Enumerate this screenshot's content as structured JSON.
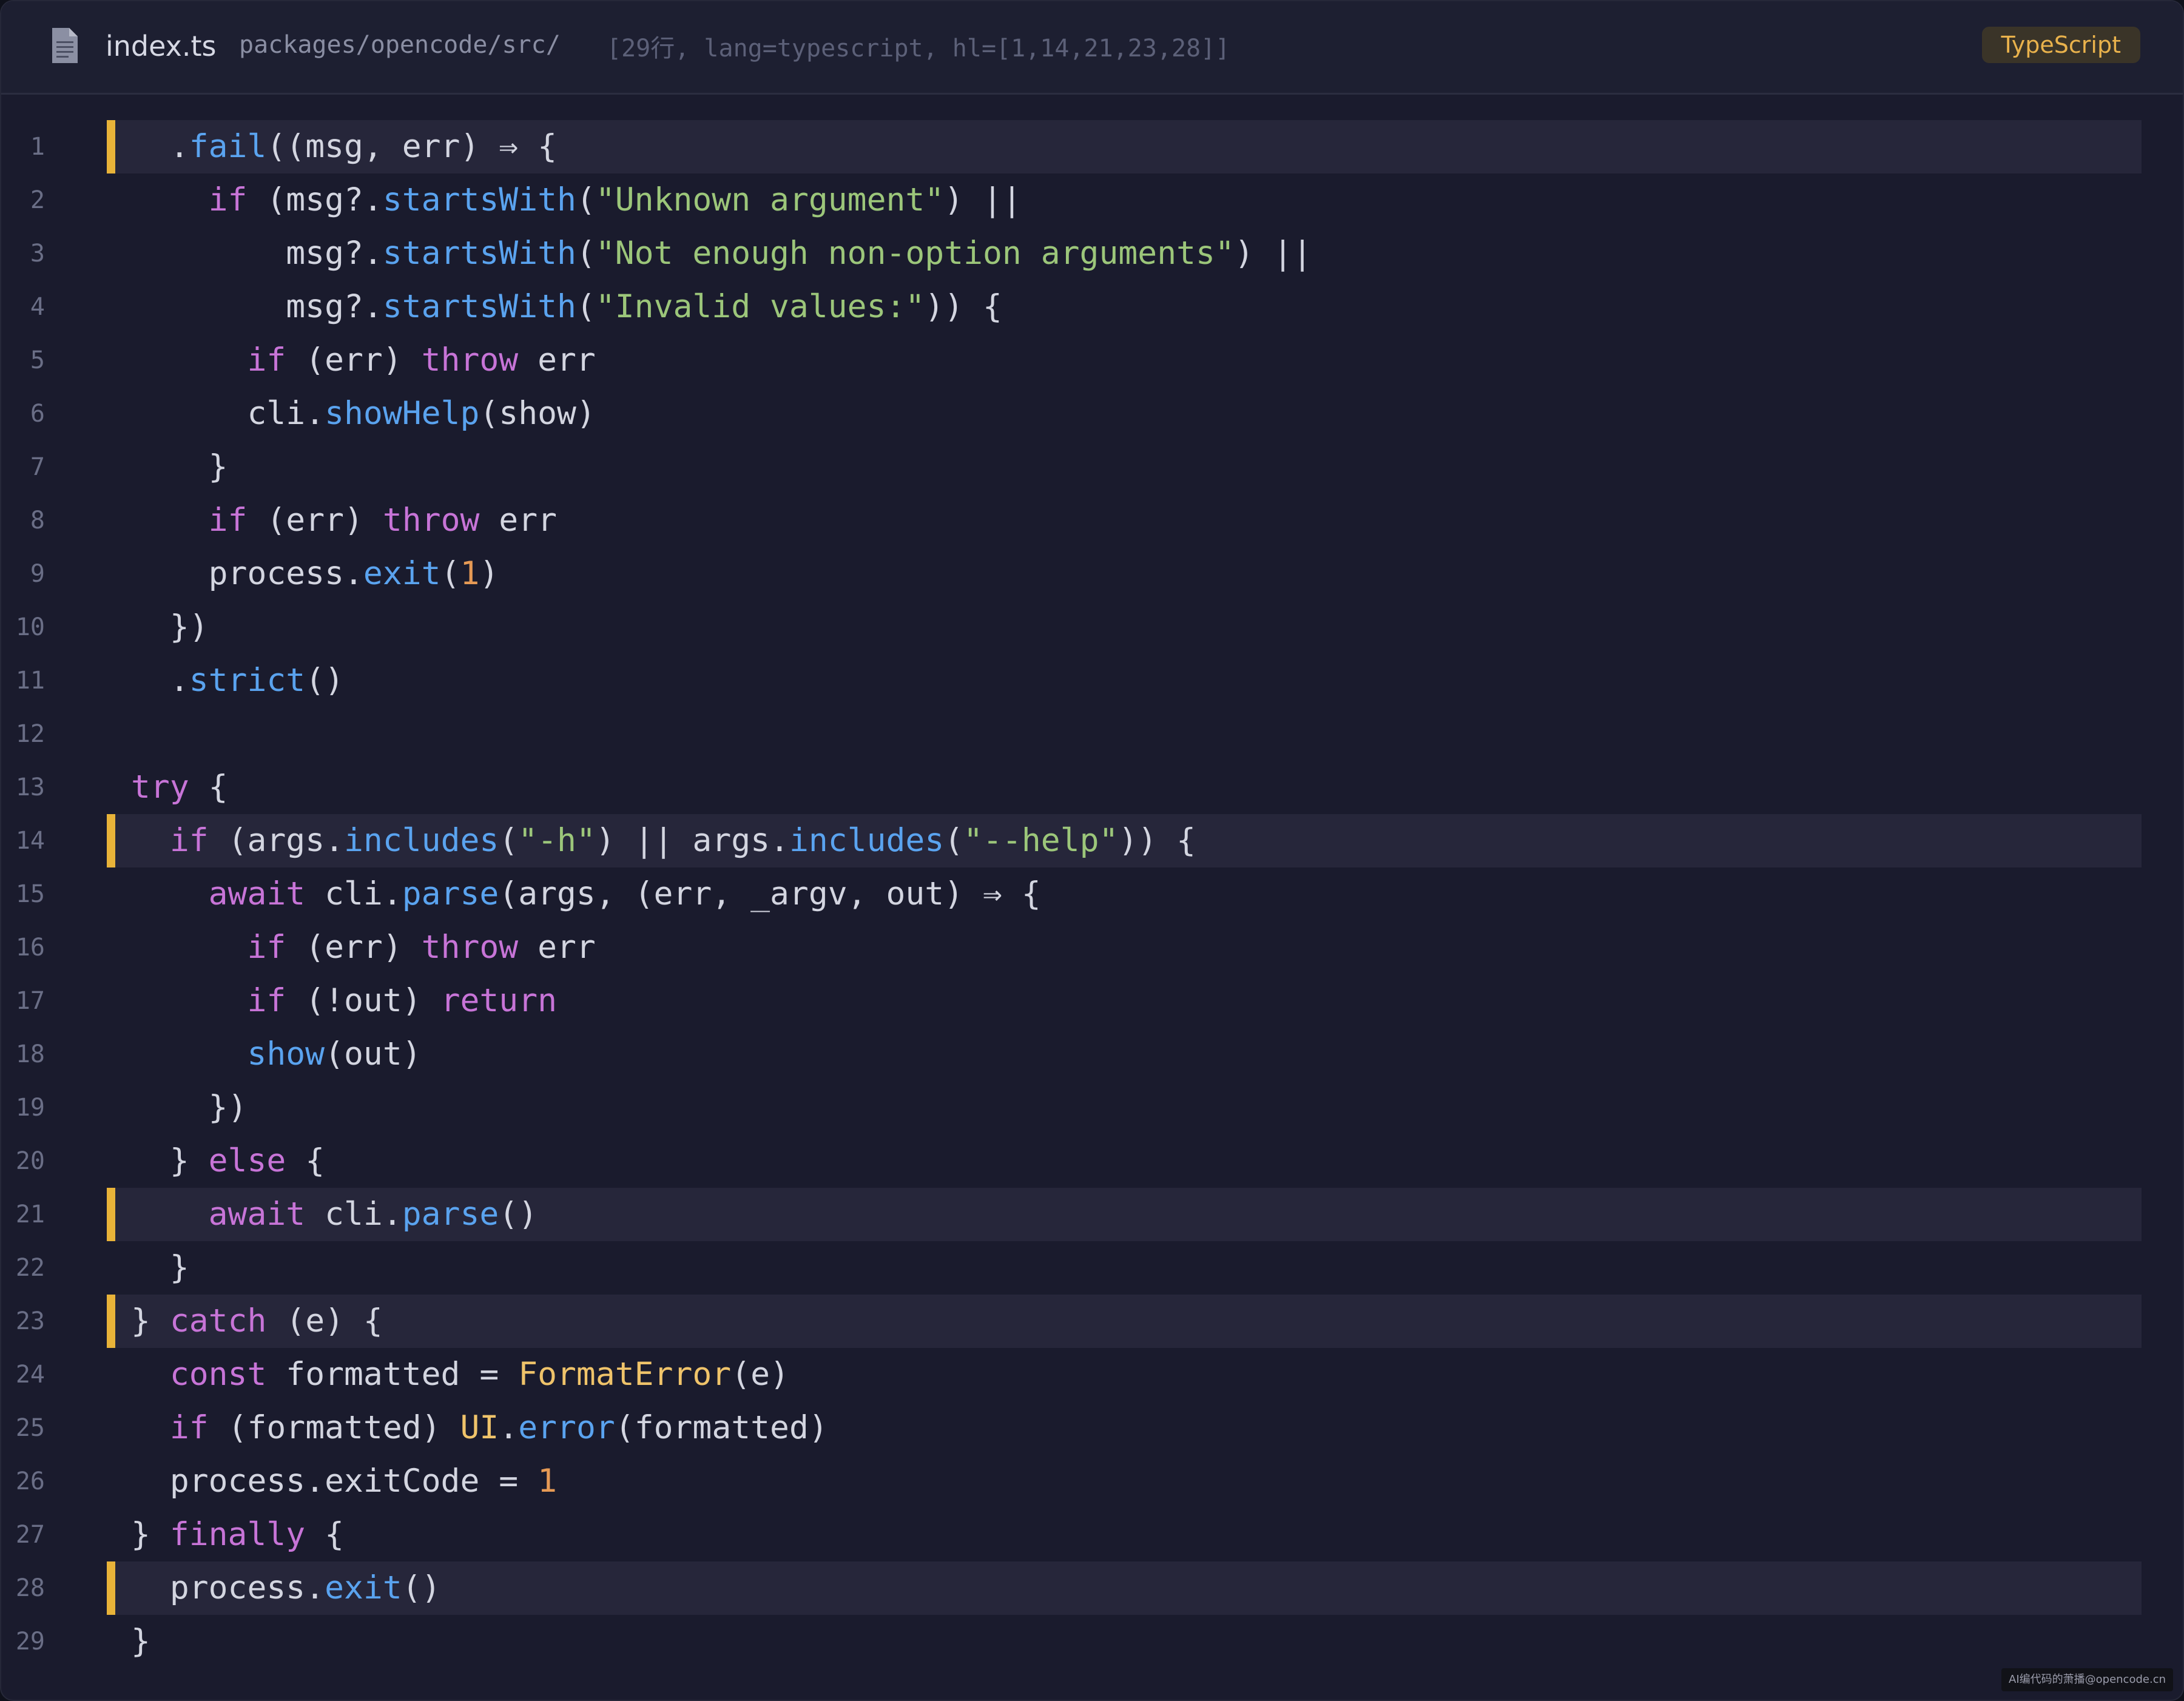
{
  "header": {
    "filename": "index.ts",
    "path": "packages/opencode/src/",
    "meta": "[29行, lang=typescript, hl=[1,14,21,23,28]]",
    "language_badge": "TypeScript",
    "file_icon": "document-icon"
  },
  "colors": {
    "background": "#1a1b2d",
    "highlight_bar": "#e8b339",
    "keyword": "#c774d7",
    "function": "#5aa3ef",
    "string": "#9cc67a",
    "number": "#e69a55",
    "type": "#efc36a"
  },
  "highlighted_lines": [
    1,
    14,
    21,
    23,
    28
  ],
  "lines": [
    {
      "n": "1",
      "tokens": [
        [
          "pl",
          "  ."
        ],
        [
          "fn",
          "fail"
        ],
        [
          "pl",
          "((msg, err) ⇒ {"
        ]
      ]
    },
    {
      "n": "2",
      "tokens": [
        [
          "pl",
          "    "
        ],
        [
          "kw",
          "if"
        ],
        [
          "pl",
          " (msg?."
        ],
        [
          "fn",
          "startsWith"
        ],
        [
          "pl",
          "("
        ],
        [
          "str",
          "\"Unknown argument\""
        ],
        [
          "pl",
          ") ||"
        ]
      ]
    },
    {
      "n": "3",
      "tokens": [
        [
          "pl",
          "        msg?."
        ],
        [
          "fn",
          "startsWith"
        ],
        [
          "pl",
          "("
        ],
        [
          "str",
          "\"Not enough non-option arguments\""
        ],
        [
          "pl",
          ") ||"
        ]
      ]
    },
    {
      "n": "4",
      "tokens": [
        [
          "pl",
          "        msg?."
        ],
        [
          "fn",
          "startsWith"
        ],
        [
          "pl",
          "("
        ],
        [
          "str",
          "\"Invalid values:\""
        ],
        [
          "pl",
          ")) {"
        ]
      ]
    },
    {
      "n": "5",
      "tokens": [
        [
          "pl",
          "      "
        ],
        [
          "kw",
          "if"
        ],
        [
          "pl",
          " (err) "
        ],
        [
          "kw",
          "throw"
        ],
        [
          "pl",
          " err"
        ]
      ]
    },
    {
      "n": "6",
      "tokens": [
        [
          "pl",
          "      cli."
        ],
        [
          "fn",
          "showHelp"
        ],
        [
          "pl",
          "(show)"
        ]
      ]
    },
    {
      "n": "7",
      "tokens": [
        [
          "pl",
          "    }"
        ]
      ]
    },
    {
      "n": "8",
      "tokens": [
        [
          "pl",
          "    "
        ],
        [
          "kw",
          "if"
        ],
        [
          "pl",
          " (err) "
        ],
        [
          "kw",
          "throw"
        ],
        [
          "pl",
          " err"
        ]
      ]
    },
    {
      "n": "9",
      "tokens": [
        [
          "pl",
          "    process."
        ],
        [
          "fn",
          "exit"
        ],
        [
          "pl",
          "("
        ],
        [
          "num",
          "1"
        ],
        [
          "pl",
          ")"
        ]
      ]
    },
    {
      "n": "10",
      "tokens": [
        [
          "pl",
          "  })"
        ]
      ]
    },
    {
      "n": "11",
      "tokens": [
        [
          "pl",
          "  ."
        ],
        [
          "fn",
          "strict"
        ],
        [
          "pl",
          "()"
        ]
      ]
    },
    {
      "n": "12",
      "tokens": []
    },
    {
      "n": "13",
      "tokens": [
        [
          "kw",
          "try"
        ],
        [
          "pl",
          " {"
        ]
      ]
    },
    {
      "n": "14",
      "tokens": [
        [
          "pl",
          "  "
        ],
        [
          "kw",
          "if"
        ],
        [
          "pl",
          " (args."
        ],
        [
          "fn",
          "includes"
        ],
        [
          "pl",
          "("
        ],
        [
          "str",
          "\"-h\""
        ],
        [
          "pl",
          ") || args."
        ],
        [
          "fn",
          "includes"
        ],
        [
          "pl",
          "("
        ],
        [
          "str",
          "\"--help\""
        ],
        [
          "pl",
          ")) {"
        ]
      ]
    },
    {
      "n": "15",
      "tokens": [
        [
          "pl",
          "    "
        ],
        [
          "kw",
          "await"
        ],
        [
          "pl",
          " cli."
        ],
        [
          "fn",
          "parse"
        ],
        [
          "pl",
          "(args, (err, _argv, out) ⇒ {"
        ]
      ]
    },
    {
      "n": "16",
      "tokens": [
        [
          "pl",
          "      "
        ],
        [
          "kw",
          "if"
        ],
        [
          "pl",
          " (err) "
        ],
        [
          "kw",
          "throw"
        ],
        [
          "pl",
          " err"
        ]
      ]
    },
    {
      "n": "17",
      "tokens": [
        [
          "pl",
          "      "
        ],
        [
          "kw",
          "if"
        ],
        [
          "pl",
          " (!out) "
        ],
        [
          "kw",
          "return"
        ]
      ]
    },
    {
      "n": "18",
      "tokens": [
        [
          "pl",
          "      "
        ],
        [
          "fn",
          "show"
        ],
        [
          "pl",
          "(out)"
        ]
      ]
    },
    {
      "n": "19",
      "tokens": [
        [
          "pl",
          "    })"
        ]
      ]
    },
    {
      "n": "20",
      "tokens": [
        [
          "pl",
          "  } "
        ],
        [
          "kw",
          "else"
        ],
        [
          "pl",
          " {"
        ]
      ]
    },
    {
      "n": "21",
      "tokens": [
        [
          "pl",
          "    "
        ],
        [
          "kw",
          "await"
        ],
        [
          "pl",
          " cli."
        ],
        [
          "fn",
          "parse"
        ],
        [
          "pl",
          "()"
        ]
      ]
    },
    {
      "n": "22",
      "tokens": [
        [
          "pl",
          "  }"
        ]
      ]
    },
    {
      "n": "23",
      "tokens": [
        [
          "pl",
          "} "
        ],
        [
          "kw",
          "catch"
        ],
        [
          "pl",
          " (e) {"
        ]
      ]
    },
    {
      "n": "24",
      "tokens": [
        [
          "pl",
          "  "
        ],
        [
          "kw",
          "const"
        ],
        [
          "pl",
          " formatted = "
        ],
        [
          "typ",
          "FormatError"
        ],
        [
          "pl",
          "(e)"
        ]
      ]
    },
    {
      "n": "25",
      "tokens": [
        [
          "pl",
          "  "
        ],
        [
          "kw",
          "if"
        ],
        [
          "pl",
          " (formatted) "
        ],
        [
          "typ",
          "UI"
        ],
        [
          "pl",
          "."
        ],
        [
          "fn",
          "error"
        ],
        [
          "pl",
          "(formatted)"
        ]
      ]
    },
    {
      "n": "26",
      "tokens": [
        [
          "pl",
          "  process.exitCode = "
        ],
        [
          "num",
          "1"
        ]
      ]
    },
    {
      "n": "27",
      "tokens": [
        [
          "pl",
          "} "
        ],
        [
          "kw",
          "finally"
        ],
        [
          "pl",
          " {"
        ]
      ]
    },
    {
      "n": "28",
      "tokens": [
        [
          "pl",
          "  process."
        ],
        [
          "fn",
          "exit"
        ],
        [
          "pl",
          "()"
        ]
      ]
    },
    {
      "n": "29",
      "tokens": [
        [
          "pl",
          "}"
        ]
      ]
    }
  ],
  "watermark": "AI编代码的萧播@opencode.cn"
}
